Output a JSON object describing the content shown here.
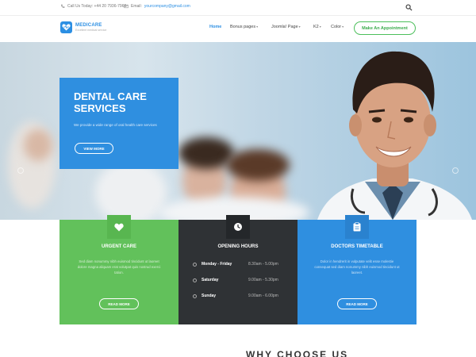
{
  "topbar": {
    "call_label": "Call Us Today: +44 20 7936-7960",
    "email_label": "Email:",
    "email_value": "yourcompany@gmail.com",
    "search_icon": "search-icon"
  },
  "logo": {
    "name": "MEDICARE",
    "tagline": "Excellent medical service"
  },
  "nav": {
    "items": [
      {
        "label": "Home",
        "active": true
      },
      {
        "label": "Bonus pages",
        "caret": "▾"
      },
      {
        "label": "Joomla! Page",
        "caret": "▾"
      },
      {
        "label": "K2",
        "caret": "▾"
      },
      {
        "label": "Color",
        "caret": "▾"
      }
    ],
    "appointment_label": "Make An Appointment"
  },
  "hero": {
    "title_line1": "DENTAL CARE",
    "title_line2": "SERVICES",
    "subtitle": "We provide a wide range of oral health care services",
    "button_label": "VIEW MORE"
  },
  "panels": {
    "urgent": {
      "title": "URGENT CARE",
      "text": "Sed diam nonummy nibh euismod tincidunt ut laoreet dolore magna aliquam erat volutpat quis nostrud exerci tation.",
      "button": "READ MORE",
      "icon": "heart-icon"
    },
    "hours": {
      "title": "OPENING HOURS",
      "icon": "clock-icon",
      "rows": [
        {
          "day": "Monday - Friday",
          "time": "8.30am - 5.00pm"
        },
        {
          "day": "Saturday",
          "time": "9.00am - 5.30pm"
        },
        {
          "day": "Sunday",
          "time": "9.00am - 6.00pm"
        }
      ]
    },
    "timetable": {
      "title": "DOCTORS TIMETABLE",
      "text": "Dolor in hendrerit in vulputate velit esse molestie consequat sed diam nonummy nibh euismod tincidunt ut laoreet.",
      "button": "READ MORE",
      "icon": "clipboard-icon"
    }
  },
  "section_heading": "WHY CHOOSE US",
  "colors": {
    "accent_blue": "#2f8fe0",
    "accent_green": "#62c15b",
    "dark": "#2f3235"
  }
}
